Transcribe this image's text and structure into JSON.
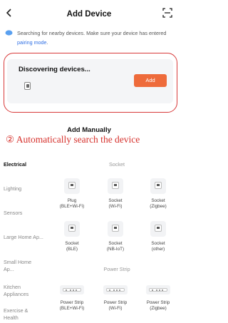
{
  "header": {
    "title": "Add Device",
    "back_icon": "chevron-left-icon",
    "scan_icon": "scan-icon"
  },
  "notice": {
    "text": "Searching for nearby devices. Make sure your device has entered ",
    "link": "pairing mode",
    "suffix": "."
  },
  "discovery": {
    "title": "Discovering devices...",
    "add_label": "Add",
    "accent": "#ee6b3b"
  },
  "manual": {
    "title": "Add Manually"
  },
  "annotation": "② Automatically search the device",
  "categories": [
    "Electrical",
    "Lighting",
    "Sensors",
    "Large Home Ap...",
    "Small Home Ap...",
    "Kitchen Appliances",
    "Exercise & Health"
  ],
  "groups": {
    "socket": "Socket",
    "power_strip": "Power Strip"
  },
  "socket_devices": [
    {
      "name": "Plug",
      "sub": "(BLE+Wi-Fi)"
    },
    {
      "name": "Socket",
      "sub": "(Wi-Fi)"
    },
    {
      "name": "Socket",
      "sub": "(Zigbee)"
    },
    {
      "name": "Socket",
      "sub": "(BLE)"
    },
    {
      "name": "Socket",
      "sub": "(NB-IoT)"
    },
    {
      "name": "Socket",
      "sub": "(other)"
    }
  ],
  "strip_devices": [
    {
      "name": "Power Strip",
      "sub": "(BLE+Wi-Fi)"
    },
    {
      "name": "Power Strip",
      "sub": "(Wi-Fi)"
    },
    {
      "name": "Power Strip",
      "sub": "(Zigbee)"
    }
  ]
}
